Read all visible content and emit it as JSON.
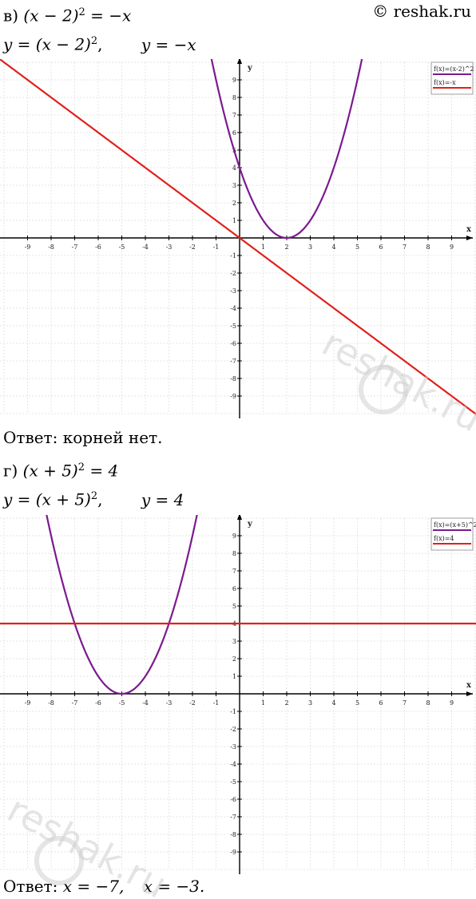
{
  "watermark": {
    "brand": "© reshak.ru",
    "overlay": "reshak.ru"
  },
  "part_v": {
    "label": "в)",
    "equation": "(x − 2)",
    "equation_rhs": " = −x",
    "functions_left": "y = (x − 2)",
    "functions_left_tail": ",",
    "functions_right": "y = −x",
    "answer_label": "Ответ:",
    "answer_text": "корней нет."
  },
  "part_g": {
    "label": "г)",
    "equation": "(x + 5)",
    "equation_rhs": " = 4",
    "functions_left": "y = (x + 5)",
    "functions_left_tail": ",",
    "functions_right": "y = 4",
    "answer_label": "Ответ:",
    "answer_x1": "x = −7,",
    "answer_x2": "x = −3."
  },
  "exponent": "2",
  "chart_data": [
    {
      "type": "line",
      "xlabel": "x",
      "ylabel": "y",
      "xlim": [
        -10,
        10
      ],
      "ylim": [
        -10,
        10
      ],
      "xticks": [
        -9,
        -8,
        -7,
        -6,
        -5,
        -4,
        -3,
        -2,
        -1,
        1,
        2,
        3,
        4,
        5,
        6,
        7,
        8,
        9
      ],
      "yticks": [
        -9,
        -8,
        -7,
        -6,
        -5,
        -4,
        -3,
        -2,
        -1,
        1,
        2,
        3,
        4,
        5,
        6,
        7,
        8,
        9
      ],
      "grid": true,
      "legend_position": "top-right",
      "series": [
        {
          "name": "f(x)=(x-2)^2",
          "color": "#7b1a8f",
          "expr": "(x-2)^2",
          "points": [
            [
              -0.9,
              8.41
            ],
            [
              0,
              4
            ],
            [
              1,
              1
            ],
            [
              2,
              0
            ],
            [
              3,
              1
            ],
            [
              4,
              4
            ],
            [
              5.1,
              9.61
            ]
          ]
        },
        {
          "name": "f(x)=-x",
          "color": "#e0201b",
          "expr": "-x",
          "points": [
            [
              -10,
              10
            ],
            [
              0,
              0
            ],
            [
              10,
              -10
            ]
          ]
        }
      ]
    },
    {
      "type": "line",
      "xlabel": "x",
      "ylabel": "y",
      "xlim": [
        -10,
        10
      ],
      "ylim": [
        -10,
        10
      ],
      "xticks": [
        -9,
        -8,
        -7,
        -6,
        -5,
        -4,
        -3,
        -2,
        -1,
        1,
        2,
        3,
        4,
        5,
        6,
        7,
        8,
        9
      ],
      "yticks": [
        -9,
        -8,
        -7,
        -6,
        -5,
        -4,
        -3,
        -2,
        -1,
        1,
        2,
        3,
        4,
        5,
        6,
        7,
        8,
        9
      ],
      "grid": true,
      "legend_position": "top-right",
      "series": [
        {
          "name": "f(x)=(x+5)^2",
          "color": "#7b1a8f",
          "expr": "(x+5)^2",
          "points": [
            [
              -8.1,
              9.61
            ],
            [
              -7,
              4
            ],
            [
              -6,
              1
            ],
            [
              -5,
              0
            ],
            [
              -4,
              1
            ],
            [
              -3,
              4
            ],
            [
              -1.9,
              9.61
            ]
          ]
        },
        {
          "name": "f(x)=4",
          "color": "#e0201b",
          "expr": "4",
          "points": [
            [
              -10,
              4
            ],
            [
              10,
              4
            ]
          ]
        }
      ]
    }
  ]
}
